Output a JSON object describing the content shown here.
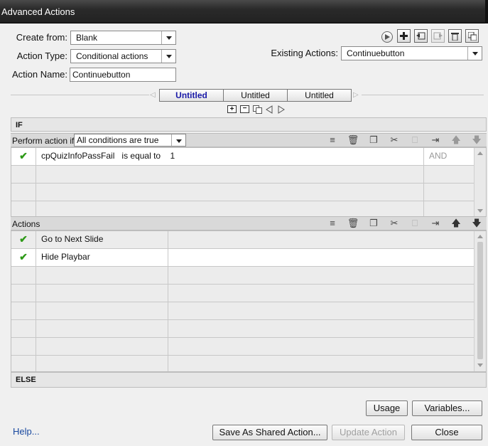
{
  "window": {
    "title": "Advanced Actions"
  },
  "form": {
    "create_from_label": "Create from:",
    "create_from_value": "Blank",
    "action_type_label": "Action Type:",
    "action_type_value": "Conditional actions",
    "action_name_label": "Action Name:",
    "action_name_value": "Continuebutton",
    "existing_actions_label": "Existing Actions:",
    "existing_actions_value": "Continuebutton"
  },
  "tabs": [
    {
      "label": "Untitled",
      "active": true
    },
    {
      "label": "Untitled",
      "active": false
    },
    {
      "label": "Untitled",
      "active": false
    }
  ],
  "if_section": {
    "title": "IF",
    "perform_label": "Perform action if:",
    "perform_value": "All conditions are true",
    "conditions": [
      {
        "variable": "cpQuizInfoPassFail",
        "operator": "is equal to",
        "value": "1",
        "logic": "AND",
        "checked": true
      }
    ]
  },
  "actions_section": {
    "title": "Actions",
    "items": [
      {
        "action": "Go to Next Slide",
        "checked": true
      },
      {
        "action": "Hide Playbar",
        "checked": true
      }
    ]
  },
  "else_section": {
    "title": "ELSE"
  },
  "buttons": {
    "usage": "Usage",
    "variables": "Variables...",
    "help": "Help...",
    "save_shared": "Save As Shared Action...",
    "update": "Update Action",
    "close": "Close"
  },
  "icons": {
    "toolbar_top": [
      "play-icon",
      "add-icon",
      "import-icon",
      "export-icon",
      "delete-icon",
      "duplicate-icon"
    ],
    "tab_controls": [
      "add-tab-icon",
      "remove-tab-icon",
      "copy-tab-icon",
      "prev-tab-icon",
      "next-tab-icon"
    ],
    "grid_toolbar": [
      "insert-row-icon",
      "trash-icon",
      "copy-icon",
      "cut-icon",
      "paste-icon",
      "insert-after-icon",
      "move-up-icon",
      "move-down-icon"
    ]
  },
  "colors": {
    "active_tab_text": "#1a1aa8",
    "check": "#2e9a18",
    "help_link": "#1a4aa0",
    "titlebar": "#2a2a2a"
  }
}
